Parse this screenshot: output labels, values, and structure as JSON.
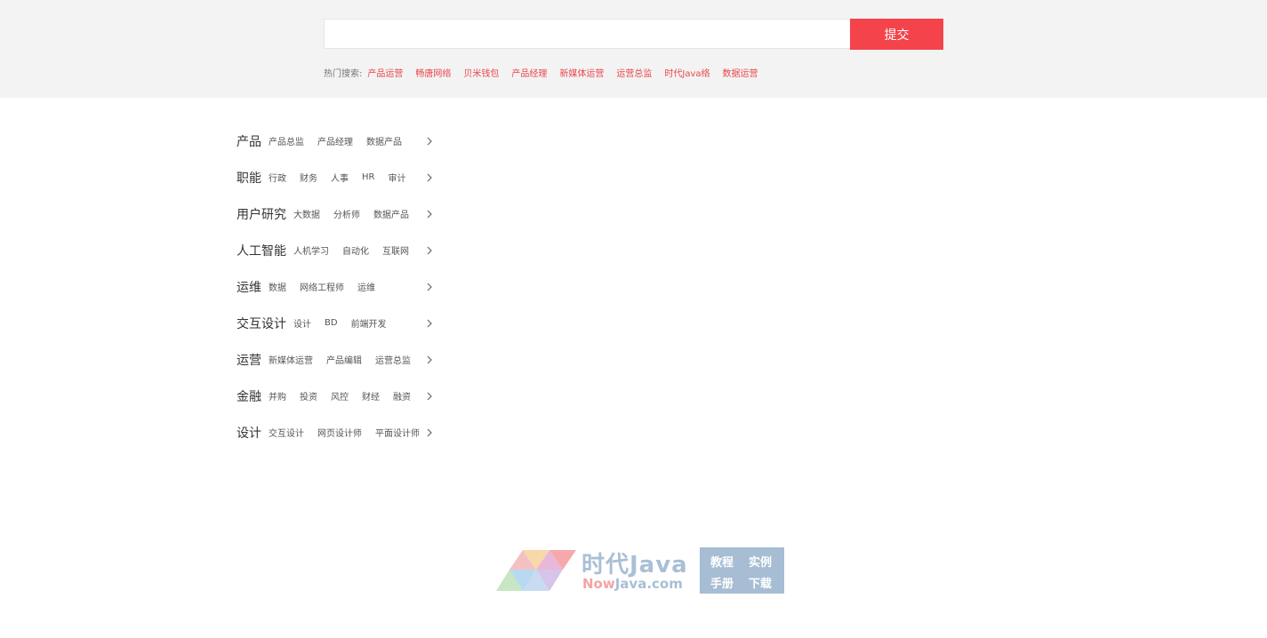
{
  "search": {
    "value": "",
    "placeholder": "",
    "submit_label": "提交",
    "hot_label": "热门搜索:",
    "hot_links": [
      "产品运营",
      "畅唐网络",
      "贝米钱包",
      "产品经理",
      "新媒体运营",
      "运营总监",
      "时代Java络",
      "数据运营"
    ]
  },
  "categories": [
    {
      "title": "产品",
      "tags": [
        "产品总监",
        "产品经理",
        "数据产品"
      ]
    },
    {
      "title": "职能",
      "tags": [
        "行政",
        "财务",
        "人事",
        "HR",
        "审计"
      ]
    },
    {
      "title": "用户研究",
      "tags": [
        "大数据",
        "分析师",
        "数据产品"
      ]
    },
    {
      "title": "人工智能",
      "tags": [
        "人机学习",
        "自动化",
        "互联网"
      ]
    },
    {
      "title": "运维",
      "tags": [
        "数据",
        "网络工程师",
        "运维"
      ]
    },
    {
      "title": "交互设计",
      "tags": [
        "设计",
        "BD",
        "前端开发"
      ]
    },
    {
      "title": "运营",
      "tags": [
        "新媒体运营",
        "产品编辑",
        "运营总监"
      ]
    },
    {
      "title": "金融",
      "tags": [
        "并购",
        "投资",
        "风控",
        "财经",
        "融资"
      ]
    },
    {
      "title": "设计",
      "tags": [
        "交互设计",
        "网页设计师",
        "平面设计师"
      ]
    }
  ],
  "icons": {
    "chevron": "chevron-right-icon",
    "logo": "triangle-logo-icon"
  },
  "colors": {
    "accent": "#f5434b",
    "link": "#e8474d",
    "band": "#f3f3f3",
    "watermark": "#a9bfd6"
  },
  "watermark": {
    "cn": "时代Java",
    "en_now": "Now",
    "en_rest": "Java.com",
    "box": [
      "教程",
      "实例",
      "手册",
      "下载"
    ]
  }
}
